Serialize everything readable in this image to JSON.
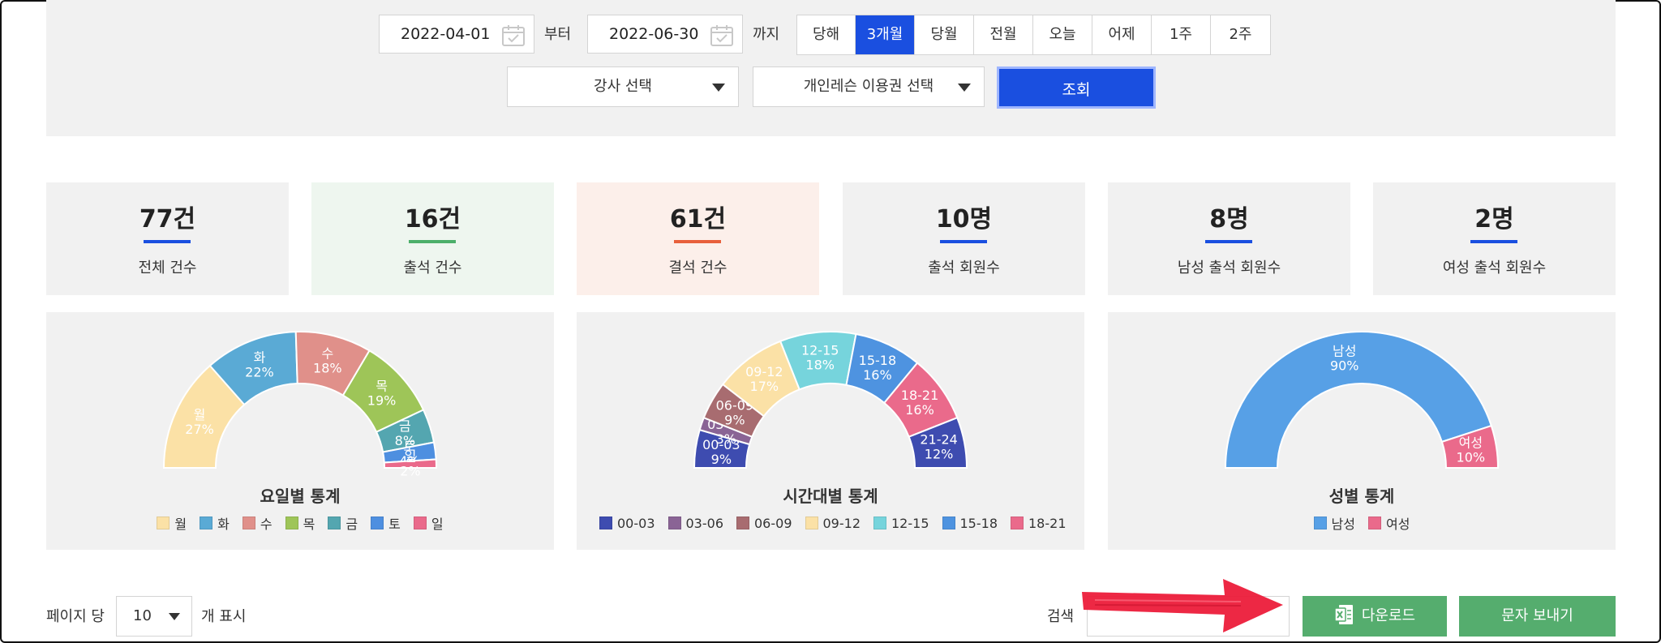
{
  "filter": {
    "start_date": "2022-04-01",
    "start_suffix": "부터",
    "end_date": "2022-06-30",
    "end_suffix": "까지",
    "periods": [
      "당해",
      "3개월",
      "당월",
      "전월",
      "오늘",
      "어제",
      "1주",
      "2주"
    ],
    "active_period": "3개월",
    "instructor_select": "강사 선택",
    "ticket_select": "개인레슨 이용권 선택",
    "search_button": "조회"
  },
  "stats": [
    {
      "value": "77건",
      "label": "전체 건수",
      "accent": "#1a4fe0",
      "bg": "#f1f1f1"
    },
    {
      "value": "16건",
      "label": "출석 건수",
      "accent": "#4caf6a",
      "bg": "#eef6ef"
    },
    {
      "value": "61건",
      "label": "결석 건수",
      "accent": "#e8603c",
      "bg": "#fcefea"
    },
    {
      "value": "10명",
      "label": "출석 회원수",
      "accent": "#1a4fe0",
      "bg": "#f1f1f1"
    },
    {
      "value": "8명",
      "label": "남성 출석 회원수",
      "accent": "#1a4fe0",
      "bg": "#f1f1f1"
    },
    {
      "value": "2명",
      "label": "여성 출석 회원수",
      "accent": "#1a4fe0",
      "bg": "#f1f1f1"
    }
  ],
  "chart_data": [
    {
      "type": "pie",
      "title": "요일별 통계",
      "categories": [
        "월",
        "화",
        "수",
        "목",
        "금",
        "토",
        "일"
      ],
      "values": [
        27,
        22,
        18,
        19,
        8,
        4,
        2
      ],
      "colors": [
        "#fbe1a6",
        "#5aaad5",
        "#e0908a",
        "#9ec558",
        "#54a6b0",
        "#4e8fe0",
        "#ea6a8b"
      ]
    },
    {
      "type": "pie",
      "title": "시간대별 통계",
      "categories": [
        "00-03",
        "03-06",
        "06-09",
        "09-12",
        "12-15",
        "15-18",
        "18-21",
        "21-24"
      ],
      "values": [
        9,
        3,
        9,
        17,
        18,
        16,
        16,
        12
      ],
      "colors": [
        "#3e4cb0",
        "#8a6495",
        "#a86c70",
        "#fbe1a6",
        "#76d4dc",
        "#4e93e0",
        "#ea6a8b",
        "#3e4cb0"
      ]
    },
    {
      "type": "pie",
      "title": "성별 통계",
      "categories": [
        "남성",
        "여성"
      ],
      "values": [
        90,
        10
      ],
      "colors": [
        "#57a0e6",
        "#ea6a8b"
      ]
    }
  ],
  "toolbar": {
    "per_page_label": "페이지 당",
    "per_page_value": "10",
    "per_page_suffix": "개 표시",
    "search_label": "검색",
    "download_button": "다운로드",
    "sms_button": "문자 보내기"
  }
}
